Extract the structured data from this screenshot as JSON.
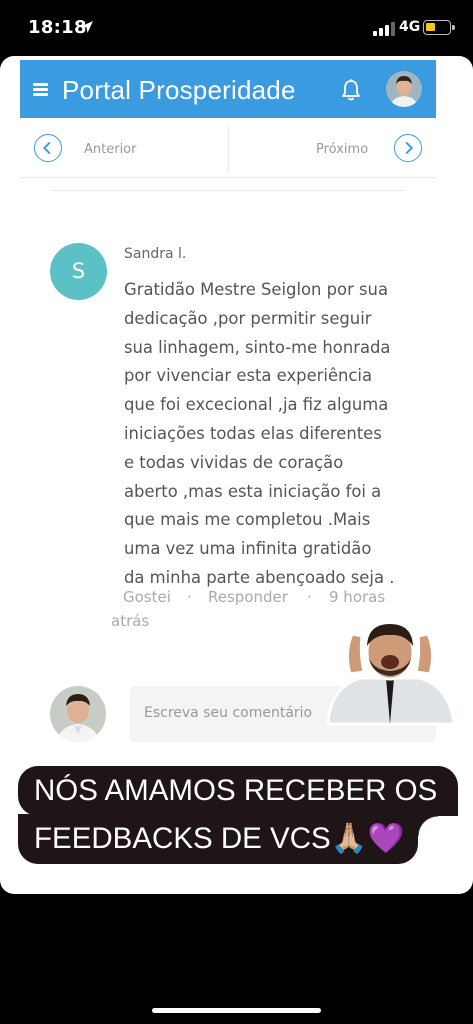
{
  "status_bar": {
    "time": "18:18",
    "network": "4G",
    "battery_color": "#f5c518"
  },
  "app": {
    "title": "Portal Prosperidade",
    "header_color": "#3b9be0",
    "icons": [
      "menu-icon",
      "bell-icon",
      "profile-avatar"
    ]
  },
  "nav": {
    "prev_label": "Anterior",
    "next_label": "Próximo"
  },
  "comment": {
    "avatar_letter": "S",
    "avatar_color": "#5cc0c7",
    "author": "Sandra l.",
    "lines": [
      "Gratidão Mestre Seiglon por sua",
      "dedicação ,por permitir seguir",
      "sua linhagem, sinto-me honrada",
      "por vivenciar esta experiência",
      "que foi excecional  ,ja fiz alguma",
      "iniciações todas elas diferentes",
      "e todas vividas de coração",
      "aberto ,mas esta iniciação foi a",
      "que mais me completou .Mais",
      "uma vez uma infinita gratidão",
      "da minha parte abençoado seja ."
    ],
    "like_label": "Gostei",
    "reply_label": "Responder",
    "separator": "·",
    "time_part1": "9 horas",
    "time_part2": "atrás"
  },
  "reply": {
    "placeholder": "Escreva seu comentário"
  },
  "caption": {
    "line1": "NÓS AMAMOS RECEBER OS",
    "line2": "FEEDBACKS DE VCS🙏🏼💜",
    "background": "#1f1416"
  }
}
